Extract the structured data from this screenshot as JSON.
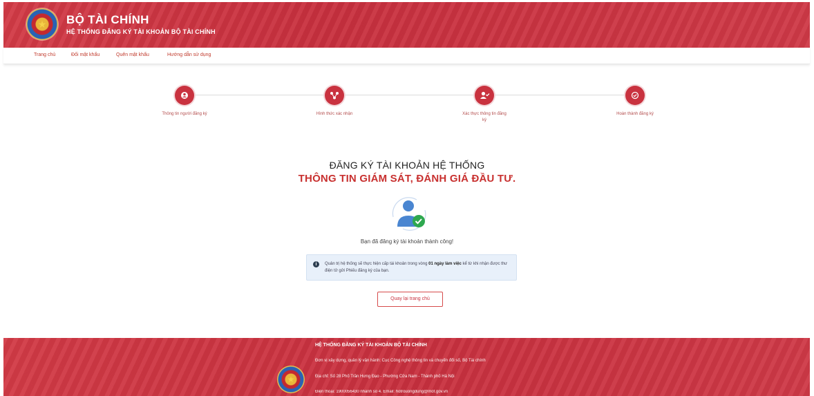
{
  "header": {
    "title": "BỘ TÀI CHÍNH",
    "subtitle": "HỆ THỐNG ĐĂNG KÝ TÀI KHOẢN BỘ TÀI CHÍNH",
    "logo_icon": "national-emblem-icon",
    "brand_color": "#c9323f"
  },
  "nav": {
    "items": [
      {
        "label": "Trang chủ"
      },
      {
        "label": "Đổi mật khẩu"
      },
      {
        "label": "Quên mật khẩu"
      },
      {
        "label": "Hướng dẫn sử dụng"
      }
    ]
  },
  "stepper": {
    "steps": [
      {
        "label": "Thông tin người đăng ký",
        "icon": "user-icon"
      },
      {
        "label": "Hình thức xác nhận",
        "icon": "share-icon"
      },
      {
        "label": "Xác thực thông tin đăng ký",
        "icon": "user-check-icon"
      },
      {
        "label": "Hoàn thành đăng ký",
        "icon": "check-circle-icon"
      }
    ]
  },
  "main": {
    "title_line1": "ĐĂNG KÝ TÀI KHOẢN HỆ THỐNG",
    "title_line2": "THÔNG TIN GIÁM SÁT, ĐÁNH GIÁ ĐẦU TƯ.",
    "illustration_icon": "user-verified-icon",
    "success_message": "Bạn đã đăng ký tài khoản thành công!",
    "notice": {
      "icon": "info-icon",
      "text_before": "Quản trị hệ thống sẽ thực hiện cấp tài khoản trong vòng ",
      "text_bold": "01 ngày làm việc",
      "text_after": " kể từ khi nhận được thư điện tử gửi Phiếu đăng ký của bạn."
    },
    "home_button_label": "Quay lại trang chủ"
  },
  "footer": {
    "title": "HỆ THỐNG ĐĂNG KÝ TÀI KHOẢN BỘ TÀI CHÍNH",
    "line1": "Đơn vị xây dựng, quản lý vận hành: Cục Công nghệ thông tin và chuyển đổi số, Bộ Tài chính",
    "line2": "Địa chỉ: Số 28 Phố Trần Hưng Đạo - Phường Cửa Nam - Thành phố Hà Nội",
    "line3": "Điện thoại: 1900056430 nhánh số 4. Email: hotrouongdung@mof.gov.vn",
    "logo_icon": "national-emblem-icon"
  }
}
